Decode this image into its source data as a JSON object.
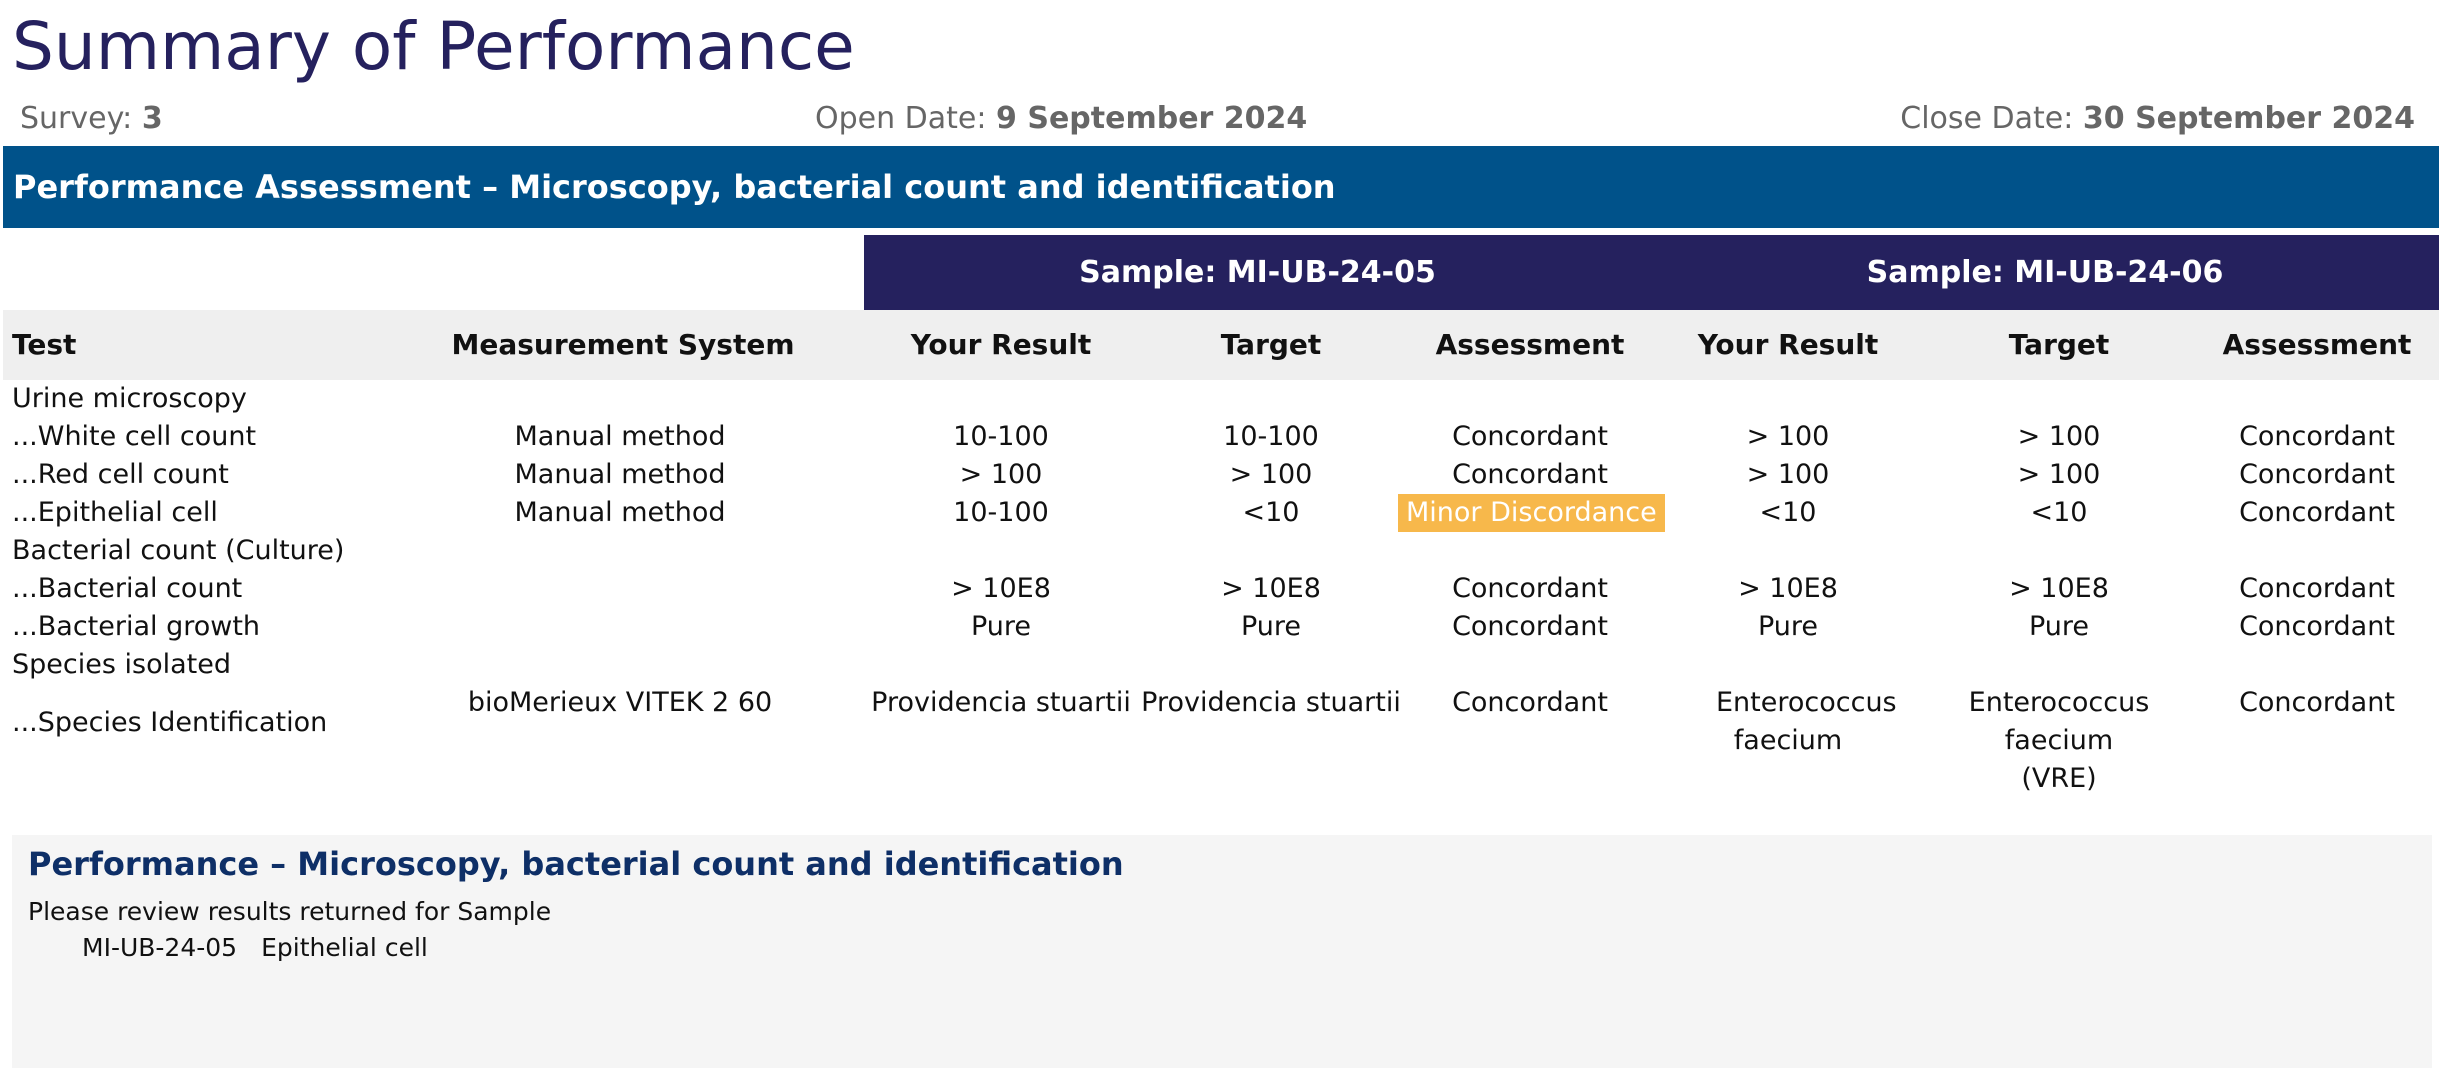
{
  "header": {
    "title": "Summary of Performance",
    "survey_label": "Survey:",
    "survey_value": "3",
    "open_label": "Open Date:",
    "open_value": "9 September 2024",
    "close_label": "Close Date:",
    "close_value": "30 September 2024"
  },
  "banner": {
    "title": "Performance Assessment – Microscopy, bacterial count and identification"
  },
  "samples": [
    "Sample: MI-UB-24-05",
    "Sample: MI-UB-24-06"
  ],
  "columns": [
    "Test",
    "Measurement System",
    "Your Result",
    "Target",
    "Assessment",
    "Your Result",
    "Target",
    "Assessment"
  ],
  "rows": [
    {
      "test": "Urine microscopy",
      "system": "",
      "r1": "",
      "t1": "",
      "a1": "",
      "r2": "",
      "t2": "",
      "a2": ""
    },
    {
      "test": "...White cell count",
      "system": "Manual method",
      "r1": "10-100",
      "t1": "10-100",
      "a1": "Concordant",
      "r2": "> 100",
      "t2": "> 100",
      "a2": "Concordant"
    },
    {
      "test": "...Red cell count",
      "system": "Manual method",
      "r1": "> 100",
      "t1": "> 100",
      "a1": "Concordant",
      "r2": "> 100",
      "t2": "> 100",
      "a2": "Concordant"
    },
    {
      "test": "...Epithelial cell",
      "system": "Manual method",
      "r1": "10-100",
      "t1": "<10",
      "a1": "Minor Discordance",
      "r2": "<10",
      "t2": "<10",
      "a2": "Concordant"
    },
    {
      "test": "Bacterial count (Culture)",
      "system": "",
      "r1": "",
      "t1": "",
      "a1": "",
      "r2": "",
      "t2": "",
      "a2": ""
    },
    {
      "test": "...Bacterial count",
      "system": "",
      "r1": "> 10E8",
      "t1": "> 10E8",
      "a1": "Concordant",
      "r2": "> 10E8",
      "t2": "> 10E8",
      "a2": "Concordant"
    },
    {
      "test": "...Bacterial growth",
      "system": "",
      "r1": "Pure",
      "t1": "Pure",
      "a1": "Concordant",
      "r2": "Pure",
      "t2": "Pure",
      "a2": "Concordant"
    },
    {
      "test": "Species isolated",
      "system": "",
      "r1": "",
      "t1": "",
      "a1": "",
      "r2": "",
      "t2": "",
      "a2": ""
    },
    {
      "test": "...Species Identification",
      "system": "bioMerieux VITEK 2 60",
      "r1": "Providencia stuartii",
      "t1": "Providencia stuartii",
      "a1": "Concordant",
      "r2": "Enterococcus faecium",
      "t2": "Enterococcus faecium (VRE)",
      "a2": "Concordant"
    }
  ],
  "colors": {
    "title": "#25215e",
    "banner": "#00528a",
    "sample_bar": "#25215e",
    "header_bg": "#efefef",
    "minor_discordance": "#f7b84b",
    "perf_title": "#0e2f67"
  },
  "performance": {
    "title": "Performance – Microscopy, bacterial count and identification",
    "line1": "Please review results returned for Sample",
    "sample": "MI-UB-24-05",
    "analyte": "Epithelial cell"
  }
}
